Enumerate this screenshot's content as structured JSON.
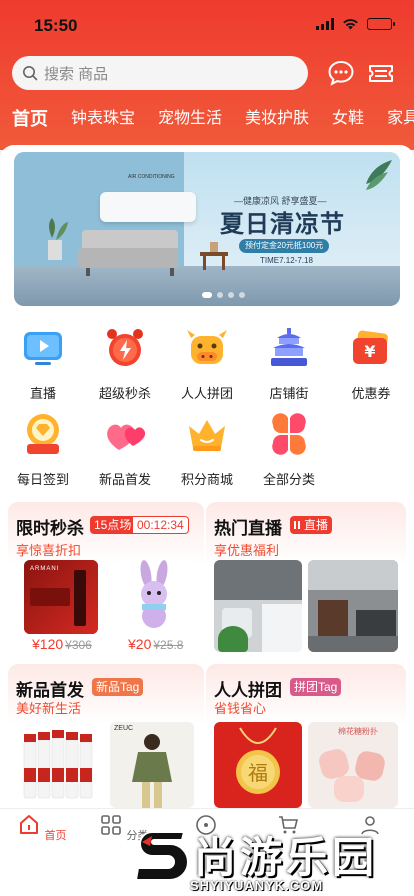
{
  "status": {
    "time": "15:50"
  },
  "search": {
    "placeholder": "搜索 商品"
  },
  "categories": [
    "首页",
    "钟表珠宝",
    "宠物生活",
    "美妆护肤",
    "女鞋",
    "家具"
  ],
  "banner": {
    "ac_label": "AIR CONDITIONING",
    "subtitle": "—健康凉风 舒享盛夏—",
    "title": "夏日清凉节",
    "tag": "预付定金20元抵100元",
    "date": "TIME7.12-7.18"
  },
  "grid": [
    {
      "label": "直播",
      "icon": "tv-icon"
    },
    {
      "label": "超级秒杀",
      "icon": "alarm-clock-icon"
    },
    {
      "label": "人人拼团",
      "icon": "cow-icon"
    },
    {
      "label": "店铺街",
      "icon": "temple-icon"
    },
    {
      "label": "优惠券",
      "icon": "coupon-icon"
    },
    {
      "label": "每日签到",
      "icon": "diamond-badge-icon"
    },
    {
      "label": "新品首发",
      "icon": "hearts-icon"
    },
    {
      "label": "积分商城",
      "icon": "crown-icon"
    },
    {
      "label": "全部分类",
      "icon": "petals-icon"
    }
  ],
  "flash": {
    "title": "限时秒杀",
    "session": "15点场",
    "countdown": "00:12:34",
    "sub": "享惊喜折扣",
    "items": [
      {
        "price": "¥120",
        "old": "¥306",
        "brand": "ARMANI"
      },
      {
        "price": "¥20",
        "old": "¥25.8"
      }
    ]
  },
  "live": {
    "title": "热门直播",
    "badge": "直播",
    "sub": "享优惠福利"
  },
  "newp": {
    "title": "新品首发",
    "tag": "新品Tag",
    "sub": "美好新生活"
  },
  "group": {
    "title": "人人拼团",
    "tag": "拼团Tag",
    "sub": "省钱省心"
  },
  "tabbar": [
    {
      "label": "首页",
      "active": true
    },
    {
      "label": "分类",
      "active": false
    }
  ],
  "watermark": {
    "main": "尚游乐园",
    "url": "SHYIYUANYK.COM"
  },
  "colors": {
    "brand": "#ef3b2f"
  }
}
